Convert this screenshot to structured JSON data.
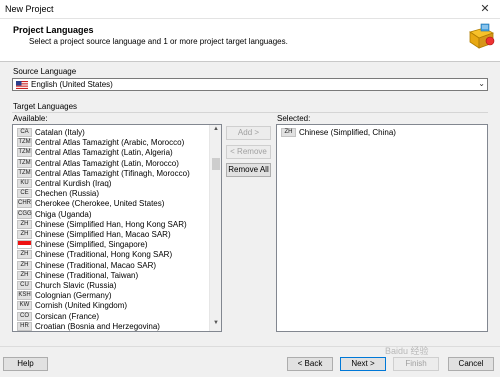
{
  "window": {
    "title": "New Project"
  },
  "header": {
    "title": "Project Languages",
    "subtitle": "Select a project source language and 1 or more project target languages."
  },
  "source": {
    "label": "Source Language",
    "value": "English (United States)",
    "flag_icon": "us-flag-icon"
  },
  "target": {
    "label": "Target Languages"
  },
  "available": {
    "label": "Available:",
    "items": [
      {
        "code": "CA",
        "name": "Catalan (Italy)"
      },
      {
        "code": "TZM",
        "name": "Central Atlas Tamazight (Arabic, Morocco)"
      },
      {
        "code": "TZM",
        "name": "Central Atlas Tamazight (Latin, Algeria)"
      },
      {
        "code": "TZM",
        "name": "Central Atlas Tamazight (Latin, Morocco)"
      },
      {
        "code": "TZM",
        "name": "Central Atlas Tamazight (Tifinagh, Morocco)"
      },
      {
        "code": "KU",
        "name": "Central Kurdish (Iraq)"
      },
      {
        "code": "CE",
        "name": "Chechen (Russia)"
      },
      {
        "code": "CHR",
        "name": "Cherokee (Cherokee, United States)"
      },
      {
        "code": "CGG",
        "name": "Chiga (Uganda)"
      },
      {
        "code": "ZH",
        "name": "Chinese (Simplified Han, Hong Kong SAR)"
      },
      {
        "code": "ZH",
        "name": "Chinese (Simplified Han, Macao SAR)"
      },
      {
        "code": "",
        "name": "Chinese (Simplified, Singapore)",
        "flag": true
      },
      {
        "code": "ZH",
        "name": "Chinese (Traditional, Hong Kong SAR)"
      },
      {
        "code": "ZH",
        "name": "Chinese (Traditional, Macao SAR)"
      },
      {
        "code": "ZH",
        "name": "Chinese (Traditional, Taiwan)"
      },
      {
        "code": "CU",
        "name": "Church Slavic (Russia)"
      },
      {
        "code": "KSH",
        "name": "Colognian (Germany)"
      },
      {
        "code": "KW",
        "name": "Cornish (United Kingdom)"
      },
      {
        "code": "CO",
        "name": "Corsican (France)"
      },
      {
        "code": "HR",
        "name": "Croatian (Bosnia and Herzegovina)"
      }
    ]
  },
  "selected": {
    "label": "Selected:",
    "items": [
      {
        "code": "ZH",
        "name": "Chinese (Simplified, China)"
      }
    ]
  },
  "buttons": {
    "add": "Add >",
    "remove": "< Remove",
    "remove_all": "Remove All",
    "help": "Help",
    "back": "< Back",
    "next": "Next >",
    "finish": "Finish",
    "cancel": "Cancel"
  },
  "watermark": "Baidu 经验"
}
